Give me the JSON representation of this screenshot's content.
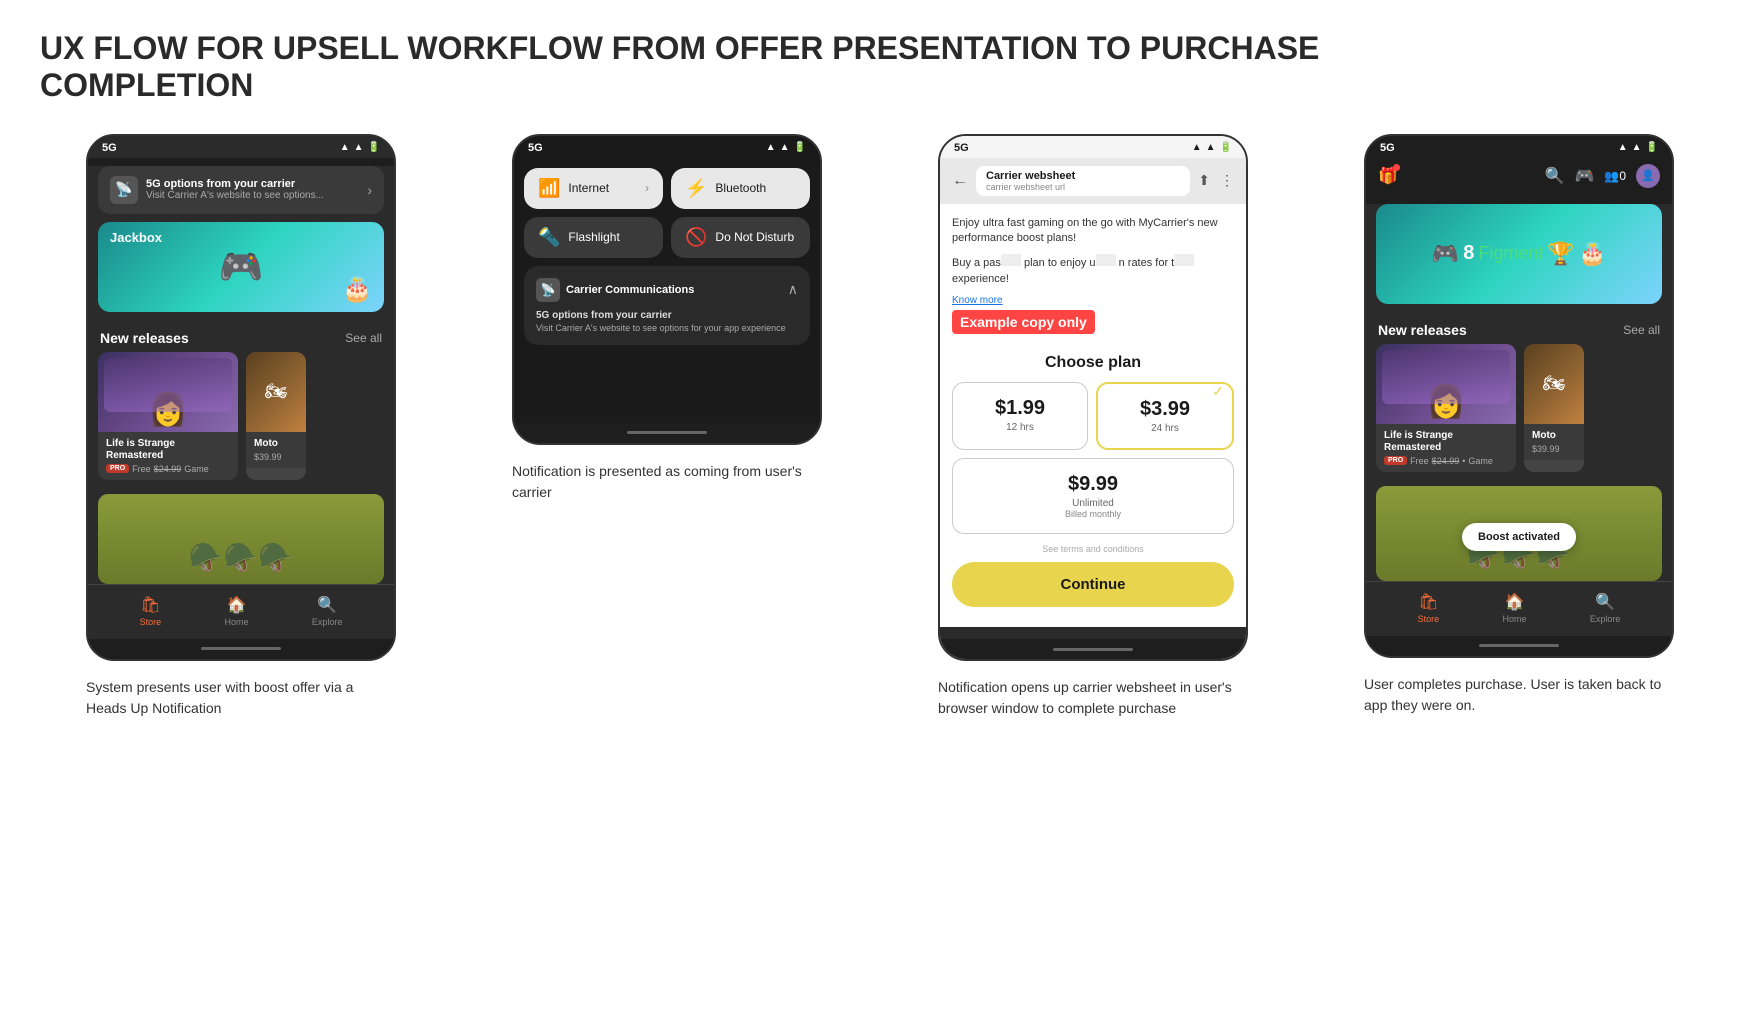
{
  "page": {
    "title_line1": "UX FLOW FOR UPSELL WORKFLOW FROM OFFER PRESENTATION TO PURCHASE",
    "title_line2": "COMPLETION"
  },
  "screen1": {
    "status": "5G",
    "notification": {
      "title": "5G options from your carrier",
      "body": "Visit Carrier A's website to see options..."
    },
    "section": "New releases",
    "see_all": "See all",
    "game1_title": "Life is Strange Remastered",
    "game1_badge": "PRO",
    "game1_price": "Free",
    "game1_price_orig": "$24.99",
    "game1_type": "Game",
    "game2_price": "$39.99",
    "nav": {
      "store": "Store",
      "home": "Home",
      "explore": "Explore"
    },
    "description": "System presents user with boost offer via a Heads Up Notification"
  },
  "screen2": {
    "status": "5G",
    "tile_internet": "Internet",
    "tile_bluetooth": "Bluetooth",
    "tile_flashlight": "Flashlight",
    "tile_dnd": "Do Not Disturb",
    "notification": {
      "header": "Carrier Communications",
      "title": "5G options from your carrier",
      "body": "Visit Carrier A's website to see options for your app experience"
    },
    "description": "Notification is presented as coming from user's carrier"
  },
  "screen3": {
    "status": "5G",
    "browser_title": "Carrier websheet",
    "browser_url": "carrier websheet url",
    "websheet_body": "Enjoy ultra fast gaming on the go with MyCarrier's new performance boost plans!",
    "websheet_body2": "Buy a pass to enjoy ultra fast rates for the best app experience!",
    "know_more": "Know more",
    "example_label": "Example copy only",
    "choose_plan": "Choose plan",
    "plan1_price": "$1.99",
    "plan1_duration": "12 hrs",
    "plan2_price": "$3.99",
    "plan2_duration": "24 hrs",
    "plan3_price": "$9.99",
    "plan3_duration": "Unlimited",
    "plan3_sub": "Billed monthly",
    "terms": "See terms and conditions",
    "continue_btn": "Continue",
    "description": "Notification opens up carrier websheet in user's browser window to complete purchase"
  },
  "screen4": {
    "status": "5G",
    "section": "New releases",
    "see_all": "See all",
    "game1_title": "Life is Strange Remastered",
    "game1_badge": "PRO",
    "game1_price": "Free",
    "game1_price_orig": "$24.99",
    "game1_type": "Game",
    "game2_price": "$39.99",
    "boost_toast": "Boost activated",
    "nav": {
      "store": "Store",
      "home": "Home",
      "explore": "Explore"
    },
    "description": "User completes purchase. User is taken back to app they were on."
  }
}
